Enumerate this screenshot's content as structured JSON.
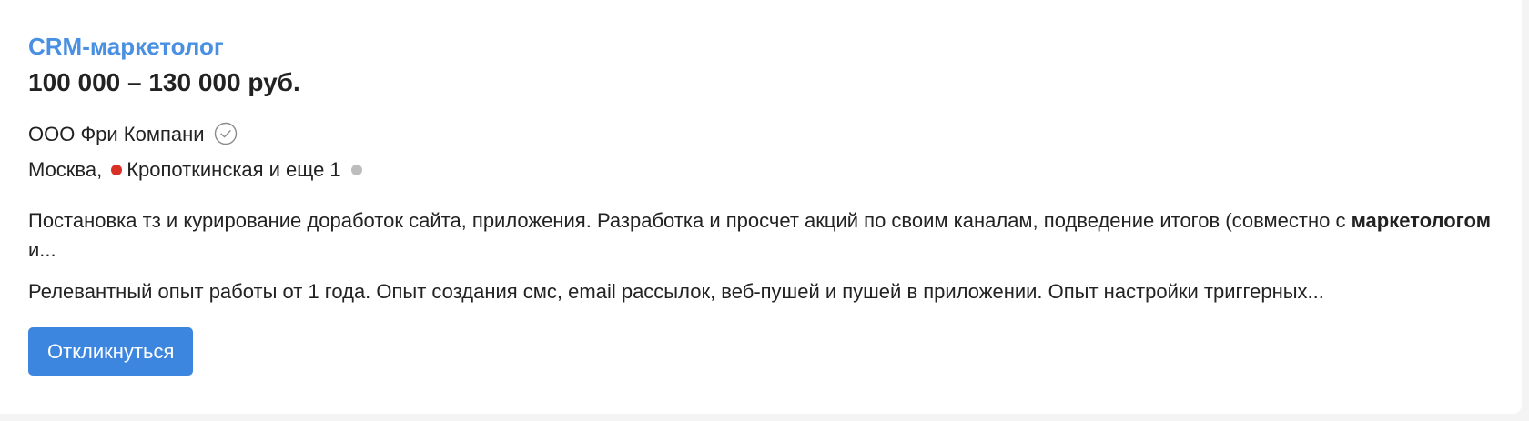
{
  "vacancy": {
    "title": "CRM-маркетолог",
    "salary": "100 000 – 130 000 руб.",
    "company": "ООО Фри Компани",
    "verified_icon": "check-circle-icon",
    "location": {
      "city": "Москва,",
      "metro": "Кропоткинская",
      "more": "и еще 1",
      "metro_color": "#d93025",
      "more_dot_color": "#bdbdbd"
    },
    "description": {
      "part1": "Постановка тз и курирование доработок сайта, приложения. Разработка и просчет акций по своим каналам, подведение итогов (совместно с ",
      "highlight": "маркетологом",
      "part2": " и..."
    },
    "requirements": "Релевантный опыт работы от 1 года. Опыт создания смс, email рассылок, веб-пушей и пушей в приложении. Опыт настройки триггерных...",
    "respond_label": "Откликнуться"
  },
  "colors": {
    "title": "#4a90e2",
    "button": "#3c86e0",
    "text": "#222222",
    "page_background": "#f4f4f5"
  }
}
